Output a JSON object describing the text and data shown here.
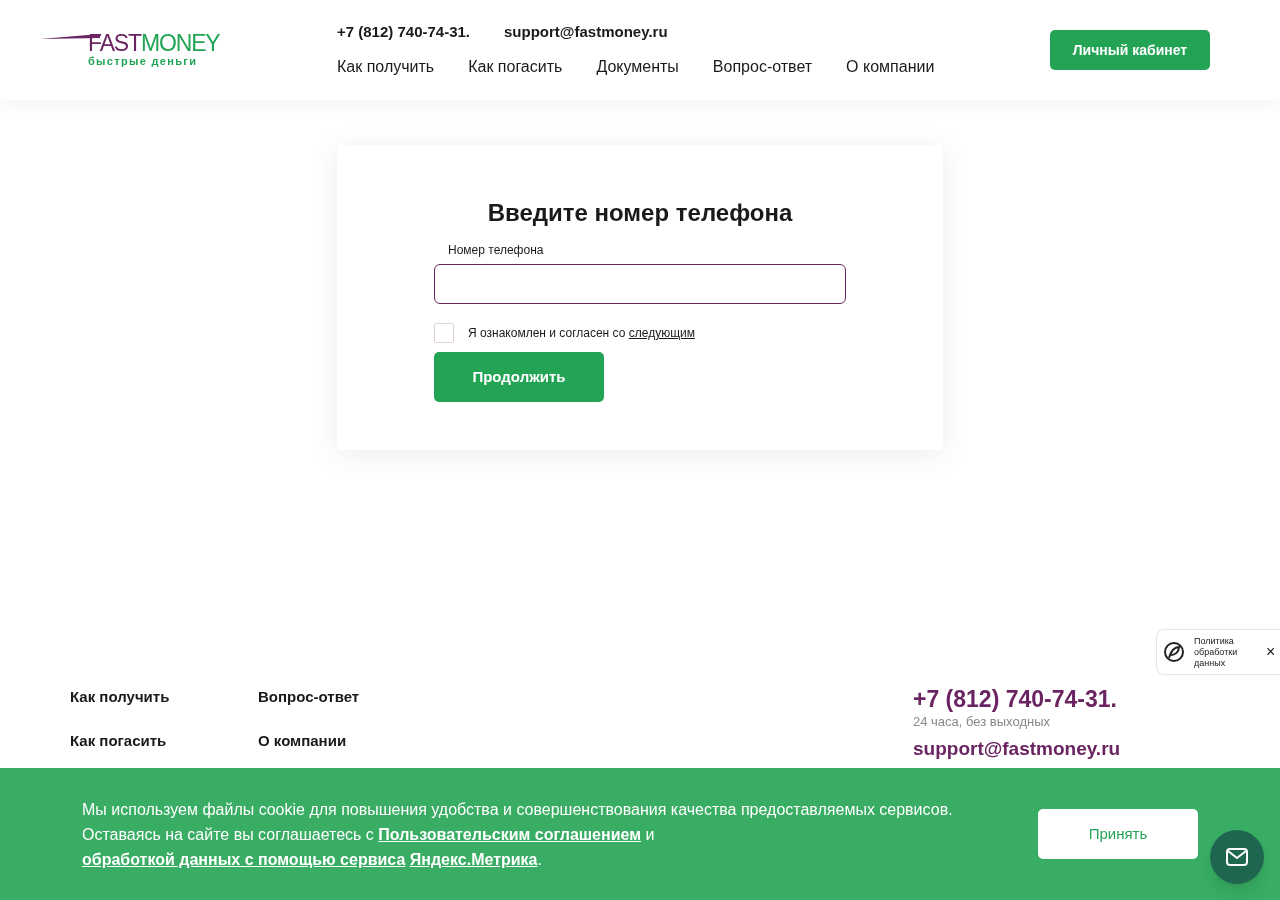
{
  "header": {
    "logo": {
      "part_1": "FAST",
      "part_2": "MONEY",
      "tagline": "быстрые деньги"
    },
    "phone": "+7 (812) 740-74-31.",
    "email": "support@fastmoney.ru",
    "nav": [
      "Как получить",
      "Как погасить",
      "Документы",
      "Вопрос-ответ",
      "О компании"
    ],
    "account_button": "Личный кабинет"
  },
  "form": {
    "title": "Введите номер телефона",
    "phone_label": "Номер телефона",
    "agree": {
      "text": "Я ознакомлен и согласен со",
      "link": "следующим",
      "checked": false
    },
    "continue_button": "Продолжить"
  },
  "policy_widget": {
    "text": "Политика обработки данных",
    "close": "×"
  },
  "footer": {
    "links": [
      [
        "Как получить",
        "Как погасить"
      ],
      [
        "Вопрос-ответ",
        "О компании"
      ]
    ],
    "phone": "+7 (812) 740-74-31.",
    "hours": "24 часа, без выходных",
    "email": "support@fastmoney.ru"
  },
  "cookie_banner": {
    "line_1": "Мы используем файлы cookie для повышения удобства и совершенствования качества предоставляемых сервисов.",
    "line_2_start": "Оставаясь на сайте вы соглашаетесь с",
    "link_1": "Пользовательским соглашением",
    "joiner": "и",
    "link_2": "обработкой данных с помощью сервиса",
    "link_3": "Яндекс.Метрика",
    "end": ".",
    "accept_button": "Принять"
  }
}
